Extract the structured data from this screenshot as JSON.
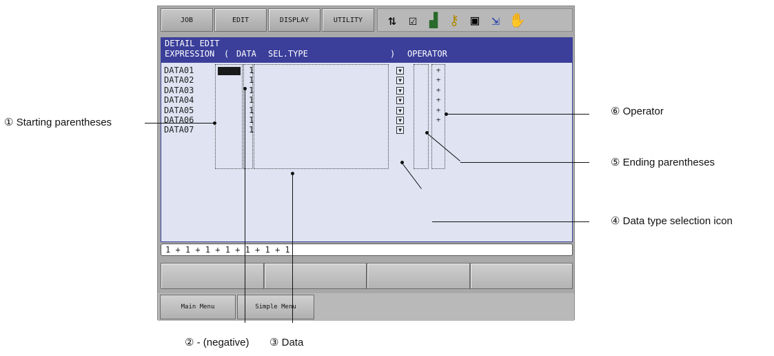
{
  "menu": {
    "tabs": [
      "JOB",
      "EDIT",
      "DISPLAY",
      "UTILITY"
    ]
  },
  "status_icons": [
    "sort-icon",
    "edit-mode-icon",
    "chart-icon",
    "key-icon",
    "layout-icon",
    "export-icon",
    "hand-icon"
  ],
  "screen": {
    "title": "DETAIL EDIT",
    "header": {
      "expression": "EXPRESSION",
      "open_paren": "(",
      "data": "DATA",
      "sel_type": "SEL.TYPE",
      "close_paren": ")",
      "operator": "OPERATOR"
    },
    "rows": [
      {
        "name": "DATA01",
        "value": "1",
        "operator": "+"
      },
      {
        "name": "DATA02",
        "value": "1",
        "operator": "+"
      },
      {
        "name": "DATA03",
        "value": "1",
        "operator": "+"
      },
      {
        "name": "DATA04",
        "value": "1",
        "operator": "+"
      },
      {
        "name": "DATA05",
        "value": "1",
        "operator": "+"
      },
      {
        "name": "DATA06",
        "value": "1",
        "operator": "+"
      },
      {
        "name": "DATA07",
        "value": "1",
        "operator": ""
      }
    ],
    "expression_line": "1 + 1 + 1 + 1 + 1 + 1 + 1"
  },
  "bottom_tabs": [
    "Main Menu",
    "Simple Menu"
  ],
  "annotations": {
    "starting_parentheses": "① Starting parentheses",
    "negative": "② - (negative)",
    "data": "③ Data",
    "data_type_selection_icon": "④ Data type selection icon",
    "ending_parentheses": "⑤ Ending parentheses",
    "operator": "⑥ Operator"
  },
  "colors": {
    "title_bar": "#3b3f9a",
    "content_bg": "#dfe3f2",
    "frame": "#a9a9a9"
  }
}
